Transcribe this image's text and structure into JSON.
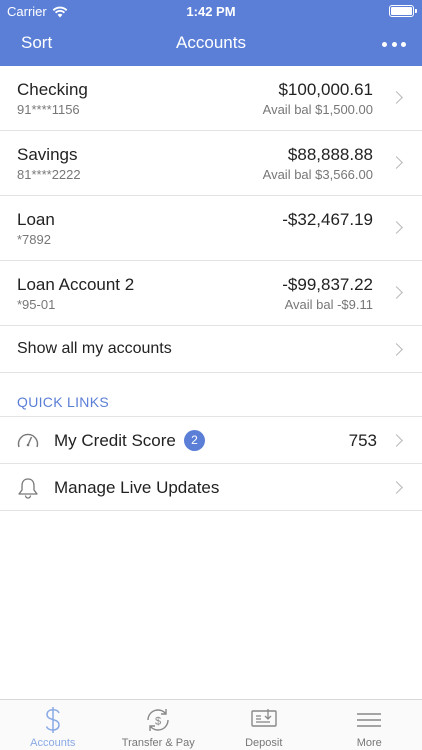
{
  "status_bar": {
    "carrier": "Carrier",
    "time": "1:42 PM"
  },
  "navbar": {
    "left_label": "Sort",
    "title": "Accounts",
    "more_icon": "more-dots-icon"
  },
  "accounts": [
    {
      "name": "Checking",
      "number": "91****1156",
      "balance": "$100,000.61",
      "available": "Avail bal $1,500.00"
    },
    {
      "name": "Savings",
      "number": "81****2222",
      "balance": "$88,888.88",
      "available": "Avail bal $3,566.00"
    },
    {
      "name": "Loan",
      "number": "*7892",
      "balance": "-$32,467.19",
      "available": ""
    },
    {
      "name": "Loan Account 2",
      "number": "*95-01",
      "balance": "-$99,837.22",
      "available": "Avail bal -$9.11"
    }
  ],
  "show_all_label": "Show all my accounts",
  "quick_links": {
    "header": "QUICK LINKS",
    "items": [
      {
        "icon": "speedometer-icon",
        "label": "My Credit Score",
        "badge": "2",
        "value": "753"
      },
      {
        "icon": "bell-icon",
        "label": "Manage Live Updates",
        "badge": "",
        "value": ""
      }
    ]
  },
  "tabbar": [
    {
      "icon": "dollar-icon",
      "label": "Accounts",
      "active": true
    },
    {
      "icon": "transfer-icon",
      "label": "Transfer & Pay",
      "active": false
    },
    {
      "icon": "check-deposit-icon",
      "label": "Deposit",
      "active": false
    },
    {
      "icon": "menu-icon",
      "label": "More",
      "active": false
    }
  ],
  "colors": {
    "accent": "#5b7fd6",
    "active_tab": "#8aaae6",
    "secondary_text": "#777777"
  }
}
